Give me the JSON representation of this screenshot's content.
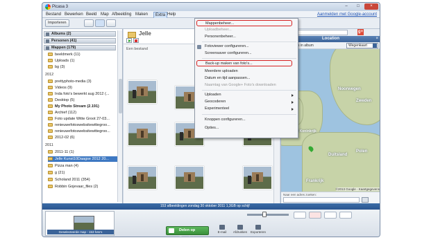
{
  "window": {
    "title": "Picasa 3"
  },
  "menubar": {
    "items": [
      "Bestand",
      "Bewerken",
      "Beeld",
      "Map",
      "Afbeelding",
      "Maken",
      "Extra",
      "Help"
    ],
    "signin": "Aanmelden met Google-account"
  },
  "toolbar": {
    "import_label": "Importeren"
  },
  "left": {
    "sections": {
      "albums": "Albums (2)",
      "people": "Personen (41)",
      "folders": "Mappen (179)"
    },
    "folders_top": [
      "beeldmerk (11)",
      "Uploads (1)",
      "bg (3)"
    ],
    "year_2012": "2012",
    "folders_2012": [
      "prettyphoto-media (3)",
      "Videos (9)",
      "Inda foto's bewerkt aug 2012 (...",
      "Desktop (5)",
      "My Photo Stream (2.191)",
      "Archief (112)",
      "Foto update Witte Groot 27-03...",
      "renieuwefotoswebsitewittegroo...",
      "renieuwefotoswebsitewittegroo...",
      "2012-02 (6)"
    ],
    "year_2011": "2011",
    "folders_2011": [
      "2011-11 (1)",
      "Jelle Kunst10Daagse 2012 20...",
      "Pizza man (4)",
      "g (21)",
      "Scholand 2011 (354)",
      "Robbin Gojevaar_files (2)"
    ]
  },
  "center": {
    "folder_name": "Jelle",
    "folder_date": "Een bestand"
  },
  "menu": {
    "items": [
      "Mappenbeheer...",
      "Uploadbeheer...",
      "Personenbeheer...",
      "Fotoviewer configureren...",
      "Screensaver configureren...",
      "Back-up maken van foto's...",
      "Meerdere uploaden",
      "Datum en tijd aanpassen...",
      "Naamtag van Google+ Foto's downloaden",
      "Uploaden",
      "Geocoderen",
      "Experimenteel",
      "Knoppen configureren...",
      "Opties..."
    ]
  },
  "right": {
    "location_title": "Location",
    "close": "×",
    "count": "11 locaties in album",
    "map_type": "Wegenkaart",
    "labels": [
      "Noorwegen",
      "Zweden",
      "Duitsland",
      "Polen",
      "Frankrijk",
      "Verenigd Koninkrijk"
    ],
    "copyright": "©2013 Google - Kaartgegevens",
    "addr_label": "Naar een adres zoeken:"
  },
  "status": {
    "text": "153 afbeeldingen   zondag 30 oktober 2011   1,3GB op schijf"
  },
  "bottom": {
    "tray_label": "Geselecteerde map - 153 foto's",
    "share": "Delen op Google+",
    "actions": [
      "E-mail",
      "Afdrukken",
      "Exporteren"
    ]
  },
  "colors": {
    "accent": "#3c6499",
    "highlight": "#d62020",
    "share": "#3a8f3a"
  }
}
